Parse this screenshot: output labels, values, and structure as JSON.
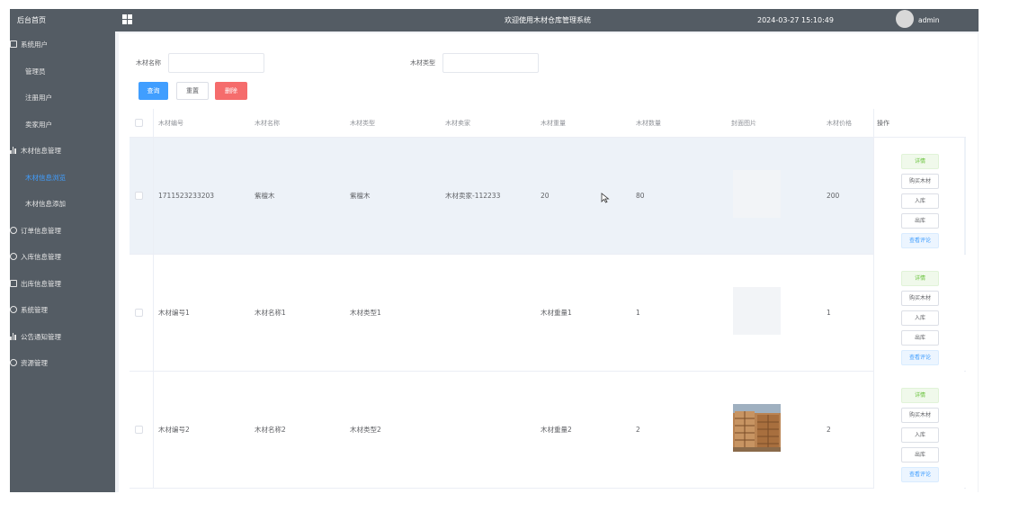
{
  "sidebar": {
    "brand": "后台首页",
    "items": [
      {
        "label": "系统用户",
        "type": "top",
        "icon": "square-icon"
      },
      {
        "label": "管理员",
        "type": "sub"
      },
      {
        "label": "注册用户",
        "type": "sub"
      },
      {
        "label": "卖家用户",
        "type": "sub"
      },
      {
        "label": "木材信息管理",
        "type": "top",
        "icon": "bar-chart-icon"
      },
      {
        "label": "木材信息浏览",
        "type": "sub",
        "active": true
      },
      {
        "label": "木材信息添加",
        "type": "sub"
      },
      {
        "label": "订单信息管理",
        "type": "top",
        "icon": "circle-icon"
      },
      {
        "label": "入库信息管理",
        "type": "top",
        "icon": "circle-icon"
      },
      {
        "label": "出库信息管理",
        "type": "top",
        "icon": "square-icon"
      },
      {
        "label": "系统管理",
        "type": "top",
        "icon": "circle-icon"
      },
      {
        "label": "公告通知管理",
        "type": "top",
        "icon": "bar-chart-icon"
      },
      {
        "label": "资源管理",
        "type": "top",
        "icon": "circle-icon"
      }
    ]
  },
  "header": {
    "title": "欢迎使用木材仓库管理系统",
    "datetime": "2024-03-27 15:10:49",
    "username": "admin"
  },
  "filters": {
    "name_label": "木材名称",
    "name_value": "",
    "type_label": "木材类型",
    "type_value": "",
    "search_label": "查询",
    "reset_label": "重置",
    "delete_label": "删除"
  },
  "table": {
    "columns": [
      "木材编号",
      "木材名称",
      "木材类型",
      "木材卖家",
      "木材重量",
      "木材数量",
      "封面图片",
      "木材价格",
      "操作"
    ],
    "rows": [
      {
        "code": "1711523233203",
        "name": "紫檀木",
        "type": "紫檀木",
        "seller": "木材卖家-112233",
        "weight": "20",
        "quantity": "80",
        "price": "200",
        "image": "placeholder"
      },
      {
        "code": "木材编号1",
        "name": "木材名称1",
        "type": "木材类型1",
        "seller": "",
        "weight": "木材重量1",
        "quantity": "1",
        "price": "1",
        "image": "placeholder"
      },
      {
        "code": "木材编号2",
        "name": "木材名称2",
        "type": "木材类型2",
        "seller": "",
        "weight": "木材重量2",
        "quantity": "2",
        "price": "2",
        "image": "wood-stack-photo"
      }
    ],
    "actions": [
      "详情",
      "购买木材",
      "入库",
      "出库",
      "查看评论"
    ]
  },
  "colors": {
    "sidebar_bg": "#545c64",
    "active": "#409eff",
    "danger": "#f56c6c",
    "success": "#67c23a",
    "row_hover": "#edf2f8"
  }
}
